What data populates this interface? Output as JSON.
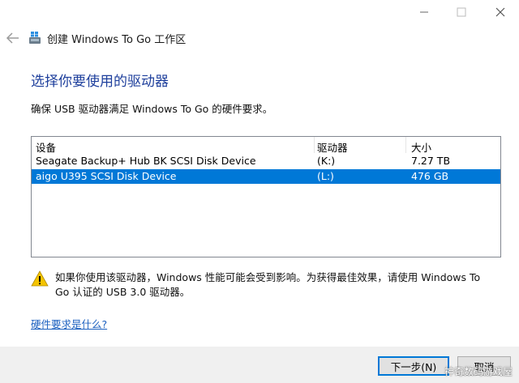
{
  "window": {
    "title": "创建 Windows To Go 工作区"
  },
  "heading": "选择你要使用的驱动器",
  "instruction": "确保 USB 驱动器满足 Windows To Go 的硬件要求。",
  "drive_list": {
    "columns": [
      "设备",
      "驱动器",
      "大小"
    ],
    "rows": [
      {
        "device": "Seagate Backup+ Hub BK SCSI Disk Device",
        "drive": "(K:)",
        "size": "7.27 TB",
        "selected": false
      },
      {
        "device": "aigo U395 SCSI Disk Device",
        "drive": "(L:)",
        "size": "476 GB",
        "selected": true
      }
    ]
  },
  "warning": {
    "text": "如果你使用该驱动器，Windows 性能可能会受到影响。为获得最佳效果，请使用 Windows To Go 认证的 USB 3.0 驱动器。"
  },
  "link": "硬件要求是什么?",
  "buttons": {
    "next": "下一步(N)",
    "cancel": "取消"
  },
  "watermark": "神奇数码游戏屋",
  "colors": {
    "accent": "#0078d7",
    "heading": "#1e3f9c",
    "link": "#1e62c0",
    "footer": "#f0f0f0"
  }
}
